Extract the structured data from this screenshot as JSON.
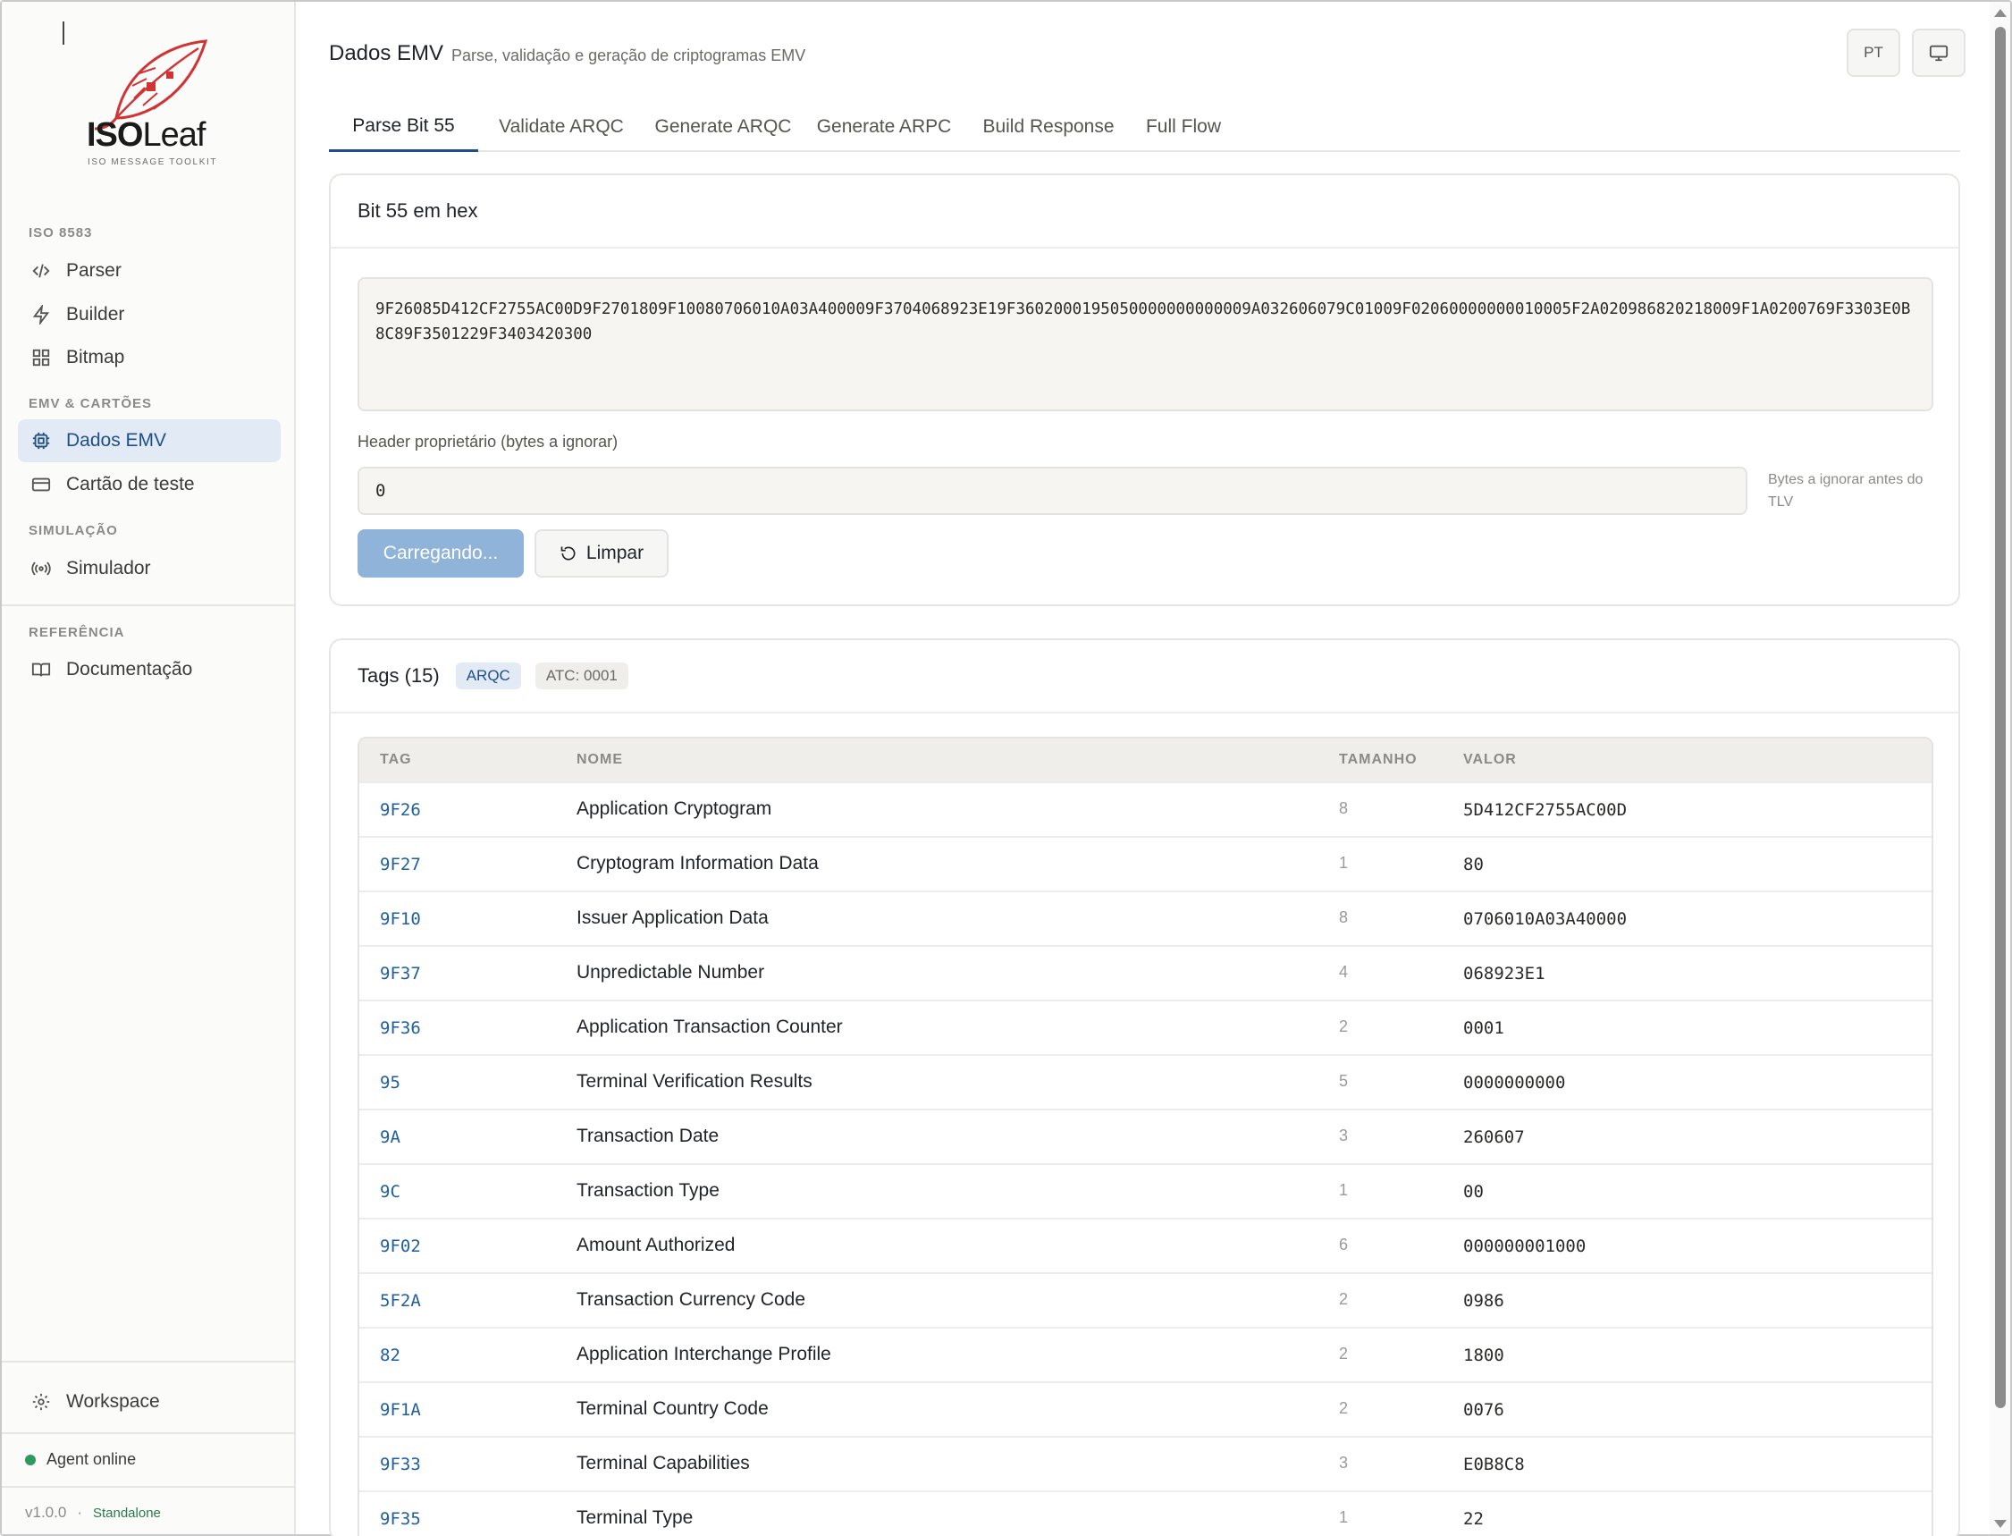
{
  "brand": {
    "logo_bold": "ISO",
    "logo_light": "Leaf",
    "tagline": "ISO MESSAGE TOOLKIT",
    "accent": "#d03434"
  },
  "sidebar": {
    "sections": [
      {
        "title": "ISO 8583",
        "items": [
          {
            "label": "Parser",
            "icon": "code-icon"
          },
          {
            "label": "Builder",
            "icon": "bolt-icon"
          },
          {
            "label": "Bitmap",
            "icon": "grid-icon"
          }
        ]
      },
      {
        "title": "EMV & CARTÕES",
        "items": [
          {
            "label": "Dados EMV",
            "icon": "chip-icon",
            "active": true
          },
          {
            "label": "Cartão de teste",
            "icon": "card-icon"
          }
        ]
      },
      {
        "title": "SIMULAÇÃO",
        "items": [
          {
            "label": "Simulador",
            "icon": "broadcast-icon"
          }
        ]
      },
      {
        "title": "REFERÊNCIA",
        "items": [
          {
            "label": "Documentação",
            "icon": "book-icon"
          }
        ]
      }
    ],
    "workspace_label": "Workspace",
    "agent_status": "Agent online",
    "version": "v1.0.0",
    "separator": "·",
    "mode": "Standalone"
  },
  "header": {
    "title": "Dados EMV",
    "subtitle": "Parse, validação e geração de criptogramas EMV",
    "lang_button": "PT"
  },
  "tabs": [
    {
      "label": "Parse Bit 55",
      "active": true
    },
    {
      "label": "Validate ARQC"
    },
    {
      "label": "Generate ARQC"
    },
    {
      "label": "Generate ARPC"
    },
    {
      "label": "Build Response"
    },
    {
      "label": "Full Flow"
    }
  ],
  "input_card": {
    "title": "Bit 55 em hex",
    "hex_value": "9F26085D412CF2755AC00D9F2701809F10080706010A03A400009F3704068923E19F3602000195050000000000009A032606079C01009F02060000000010005F2A020986820218009F1A0200769F3303E0B8C89F3501229F3403420300",
    "header_label": "Header proprietário (bytes a ignorar)",
    "header_value": "0",
    "header_hint": "Bytes a ignorar antes do TLV",
    "load_button": "Carregando...",
    "clear_button": "Limpar"
  },
  "tags_card": {
    "title": "Tags (15)",
    "badge_type": "ARQC",
    "badge_atc": "ATC: 0001",
    "columns": [
      "TAG",
      "NOME",
      "TAMANHO",
      "VALOR"
    ],
    "rows": [
      {
        "tag": "9F26",
        "name": "Application Cryptogram",
        "size": "8",
        "value": "5D412CF2755AC00D"
      },
      {
        "tag": "9F27",
        "name": "Cryptogram Information Data",
        "size": "1",
        "value": "80"
      },
      {
        "tag": "9F10",
        "name": "Issuer Application Data",
        "size": "8",
        "value": "0706010A03A40000"
      },
      {
        "tag": "9F37",
        "name": "Unpredictable Number",
        "size": "4",
        "value": "068923E1"
      },
      {
        "tag": "9F36",
        "name": "Application Transaction Counter",
        "size": "2",
        "value": "0001"
      },
      {
        "tag": "95",
        "name": "Terminal Verification Results",
        "size": "5",
        "value": "0000000000"
      },
      {
        "tag": "9A",
        "name": "Transaction Date",
        "size": "3",
        "value": "260607"
      },
      {
        "tag": "9C",
        "name": "Transaction Type",
        "size": "1",
        "value": "00"
      },
      {
        "tag": "9F02",
        "name": "Amount Authorized",
        "size": "6",
        "value": "000000001000"
      },
      {
        "tag": "5F2A",
        "name": "Transaction Currency Code",
        "size": "2",
        "value": "0986"
      },
      {
        "tag": "82",
        "name": "Application Interchange Profile",
        "size": "2",
        "value": "1800"
      },
      {
        "tag": "9F1A",
        "name": "Terminal Country Code",
        "size": "2",
        "value": "0076"
      },
      {
        "tag": "9F33",
        "name": "Terminal Capabilities",
        "size": "3",
        "value": "E0B8C8"
      },
      {
        "tag": "9F35",
        "name": "Terminal Type",
        "size": "1",
        "value": "22"
      }
    ]
  }
}
